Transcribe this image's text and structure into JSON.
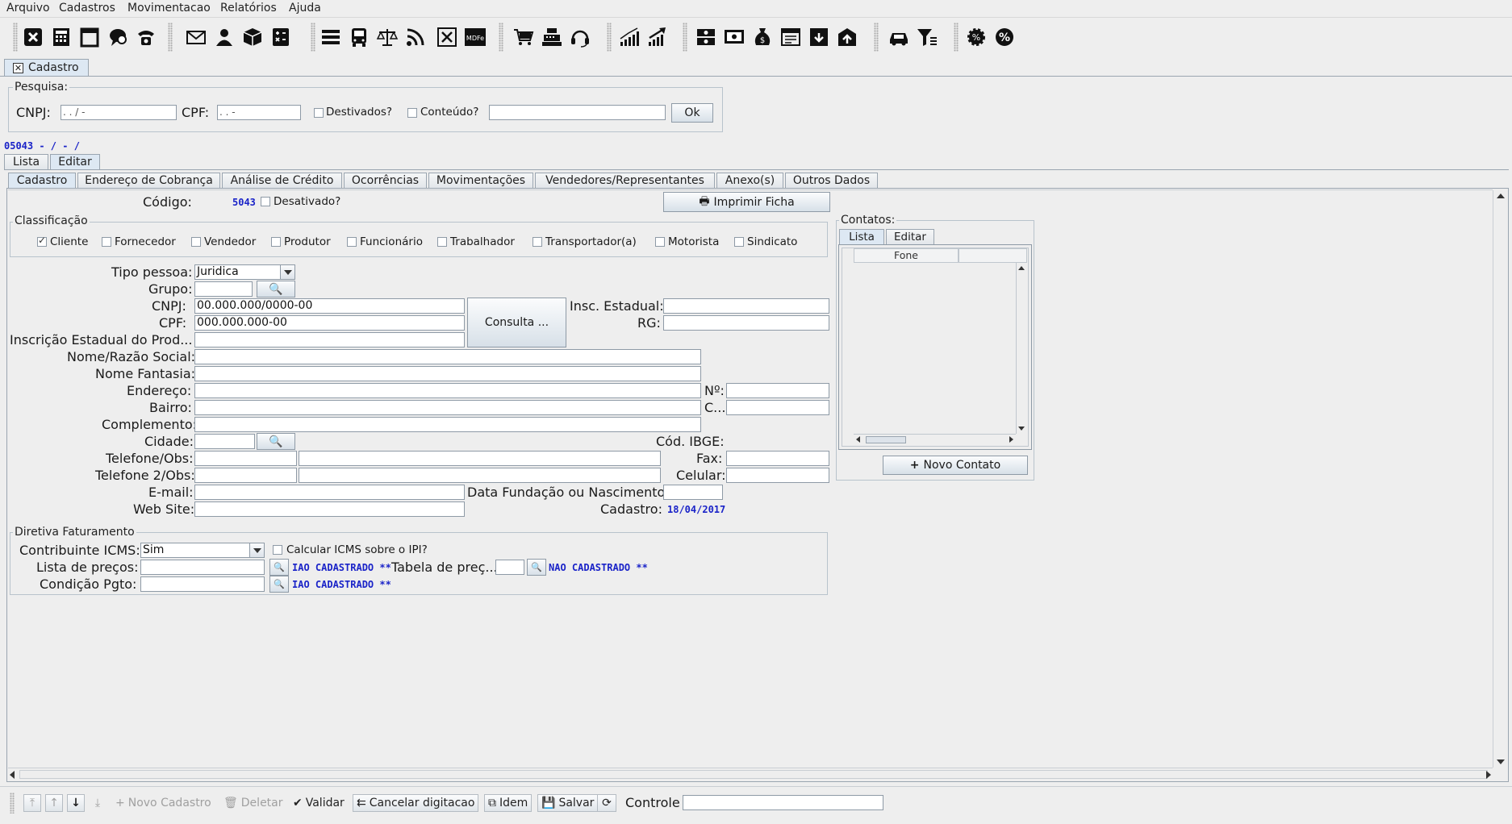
{
  "menu": [
    "Arquivo",
    "Cadastros",
    "Movimentacao",
    "Relatórios",
    "Ajuda"
  ],
  "toolbar_icons": [
    "close-icon",
    "calculator-icon",
    "notepad-icon",
    "chat-icon",
    "phone-icon",
    "mail-icon",
    "person-icon",
    "box-icon",
    "calculator-grid-icon",
    "list-icon",
    "bus-icon",
    "scale-icon",
    "feed-icon",
    "cancel-icon",
    "mdfe-icon",
    "cart-icon",
    "cash-register-icon",
    "headset-icon",
    "chart-up-icon",
    "chart-arrow-icon",
    "money-icon",
    "money-2-icon",
    "money-bag-icon",
    "register-icon",
    "box-down-icon",
    "box-up-icon",
    "car-icon",
    "filter-icon",
    "gear-icon",
    "percent-icon"
  ],
  "mdfe_label": "MDFe",
  "window_tab": "Cadastro",
  "pesquisa": {
    "legend": "Pesquisa:",
    "cnpj_label": "CNPJ:",
    "cnpj_mask": ".   .   /    -",
    "cpf_label": "CPF:",
    "cpf_mask": ".   .   -",
    "desativados_label": "Destivados?",
    "conteudo_label": "Conteúdo?",
    "ok_label": "Ok"
  },
  "record_header": "05043 -   /   - /",
  "view_tabs": [
    "Lista",
    "Editar"
  ],
  "sub_tabs": [
    "Cadastro",
    "Endereço de Cobrança",
    "Análise de Crédito",
    "Ocorrências",
    "Movimentações",
    "Vendedores/Representantes",
    "Anexo(s)",
    "Outros Dados"
  ],
  "form": {
    "codigo_label": "Código:",
    "codigo_value": "5043",
    "desativado_label": "Desativado?",
    "imprimir_label": "Imprimir Ficha",
    "classificacao_legend": "Classificação",
    "classificacao": [
      {
        "label": "Cliente",
        "checked": true
      },
      {
        "label": "Fornecedor",
        "checked": false
      },
      {
        "label": "Vendedor",
        "checked": false
      },
      {
        "label": "Produtor",
        "checked": false
      },
      {
        "label": "Funcionário",
        "checked": false
      },
      {
        "label": "Trabalhador",
        "checked": false
      },
      {
        "label": "Transportador(a)",
        "checked": false
      },
      {
        "label": "Motorista",
        "checked": false
      },
      {
        "label": "Sindicato",
        "checked": false
      }
    ],
    "tipo_pessoa_label": "Tipo pessoa:",
    "tipo_pessoa_value": "Juridica",
    "grupo_label": "Grupo:",
    "cnpj_label": "CNPJ:",
    "cnpj_value": "00.000.000/0000-00",
    "cpf_label": "CPF:",
    "cpf_value": "000.000.000-00",
    "consulta_label": "Consulta ...",
    "insc_estadual_label": "Insc. Estadual:",
    "rg_label": "RG:",
    "insc_produtor_label": "Inscrição Estadual do  Prod...",
    "nome_label": "Nome/Razão Social:",
    "fantasia_label": "Nome Fantasia:",
    "endereco_label": "Endereço:",
    "numero_label": "Nº:",
    "bairro_label": "Bairro:",
    "cep_label": "C...",
    "complemento_label": "Complemento:",
    "cidade_label": "Cidade:",
    "ibge_label": "Cód. IBGE:",
    "telefone_label": "Telefone/Obs:",
    "fax_label": "Fax:",
    "telefone2_label": "Telefone 2/Obs:",
    "celular_label": "Celular:",
    "email_label": "E-mail:",
    "fundacao_label": "Data Fundação ou Nascimento:",
    "website_label": "Web Site:",
    "cadastro_label": "Cadastro:",
    "cadastro_value": "18/04/2017"
  },
  "faturamento": {
    "legend": "Diretiva Faturamento",
    "contribuinte_label": "Contribuinte ICMS:",
    "contribuinte_value": "Sim",
    "calcular_label": "Calcular ICMS sobre o IPI?",
    "lista_label": "Lista de preços:",
    "lista_status": "IAO CADASTRADO   **",
    "tabela_label": "Tabela de preç...",
    "tabela_status": "NAO CADASTRADO   **",
    "condicao_label": "Condição Pgto:",
    "condicao_status": "IAO CADASTRADO   **"
  },
  "contatos": {
    "legend": "Contatos:",
    "tabs": [
      "Lista",
      "Editar"
    ],
    "columns": [
      "",
      "Fone",
      ""
    ],
    "novo_label": "Novo Contato"
  },
  "bottom": {
    "novo_cadastro": "Novo Cadastro",
    "deletar": "Deletar",
    "validar": "Validar",
    "cancelar": "Cancelar digitacao",
    "idem": "Idem",
    "salvar": "Salvar",
    "controle_label": "Controle"
  }
}
